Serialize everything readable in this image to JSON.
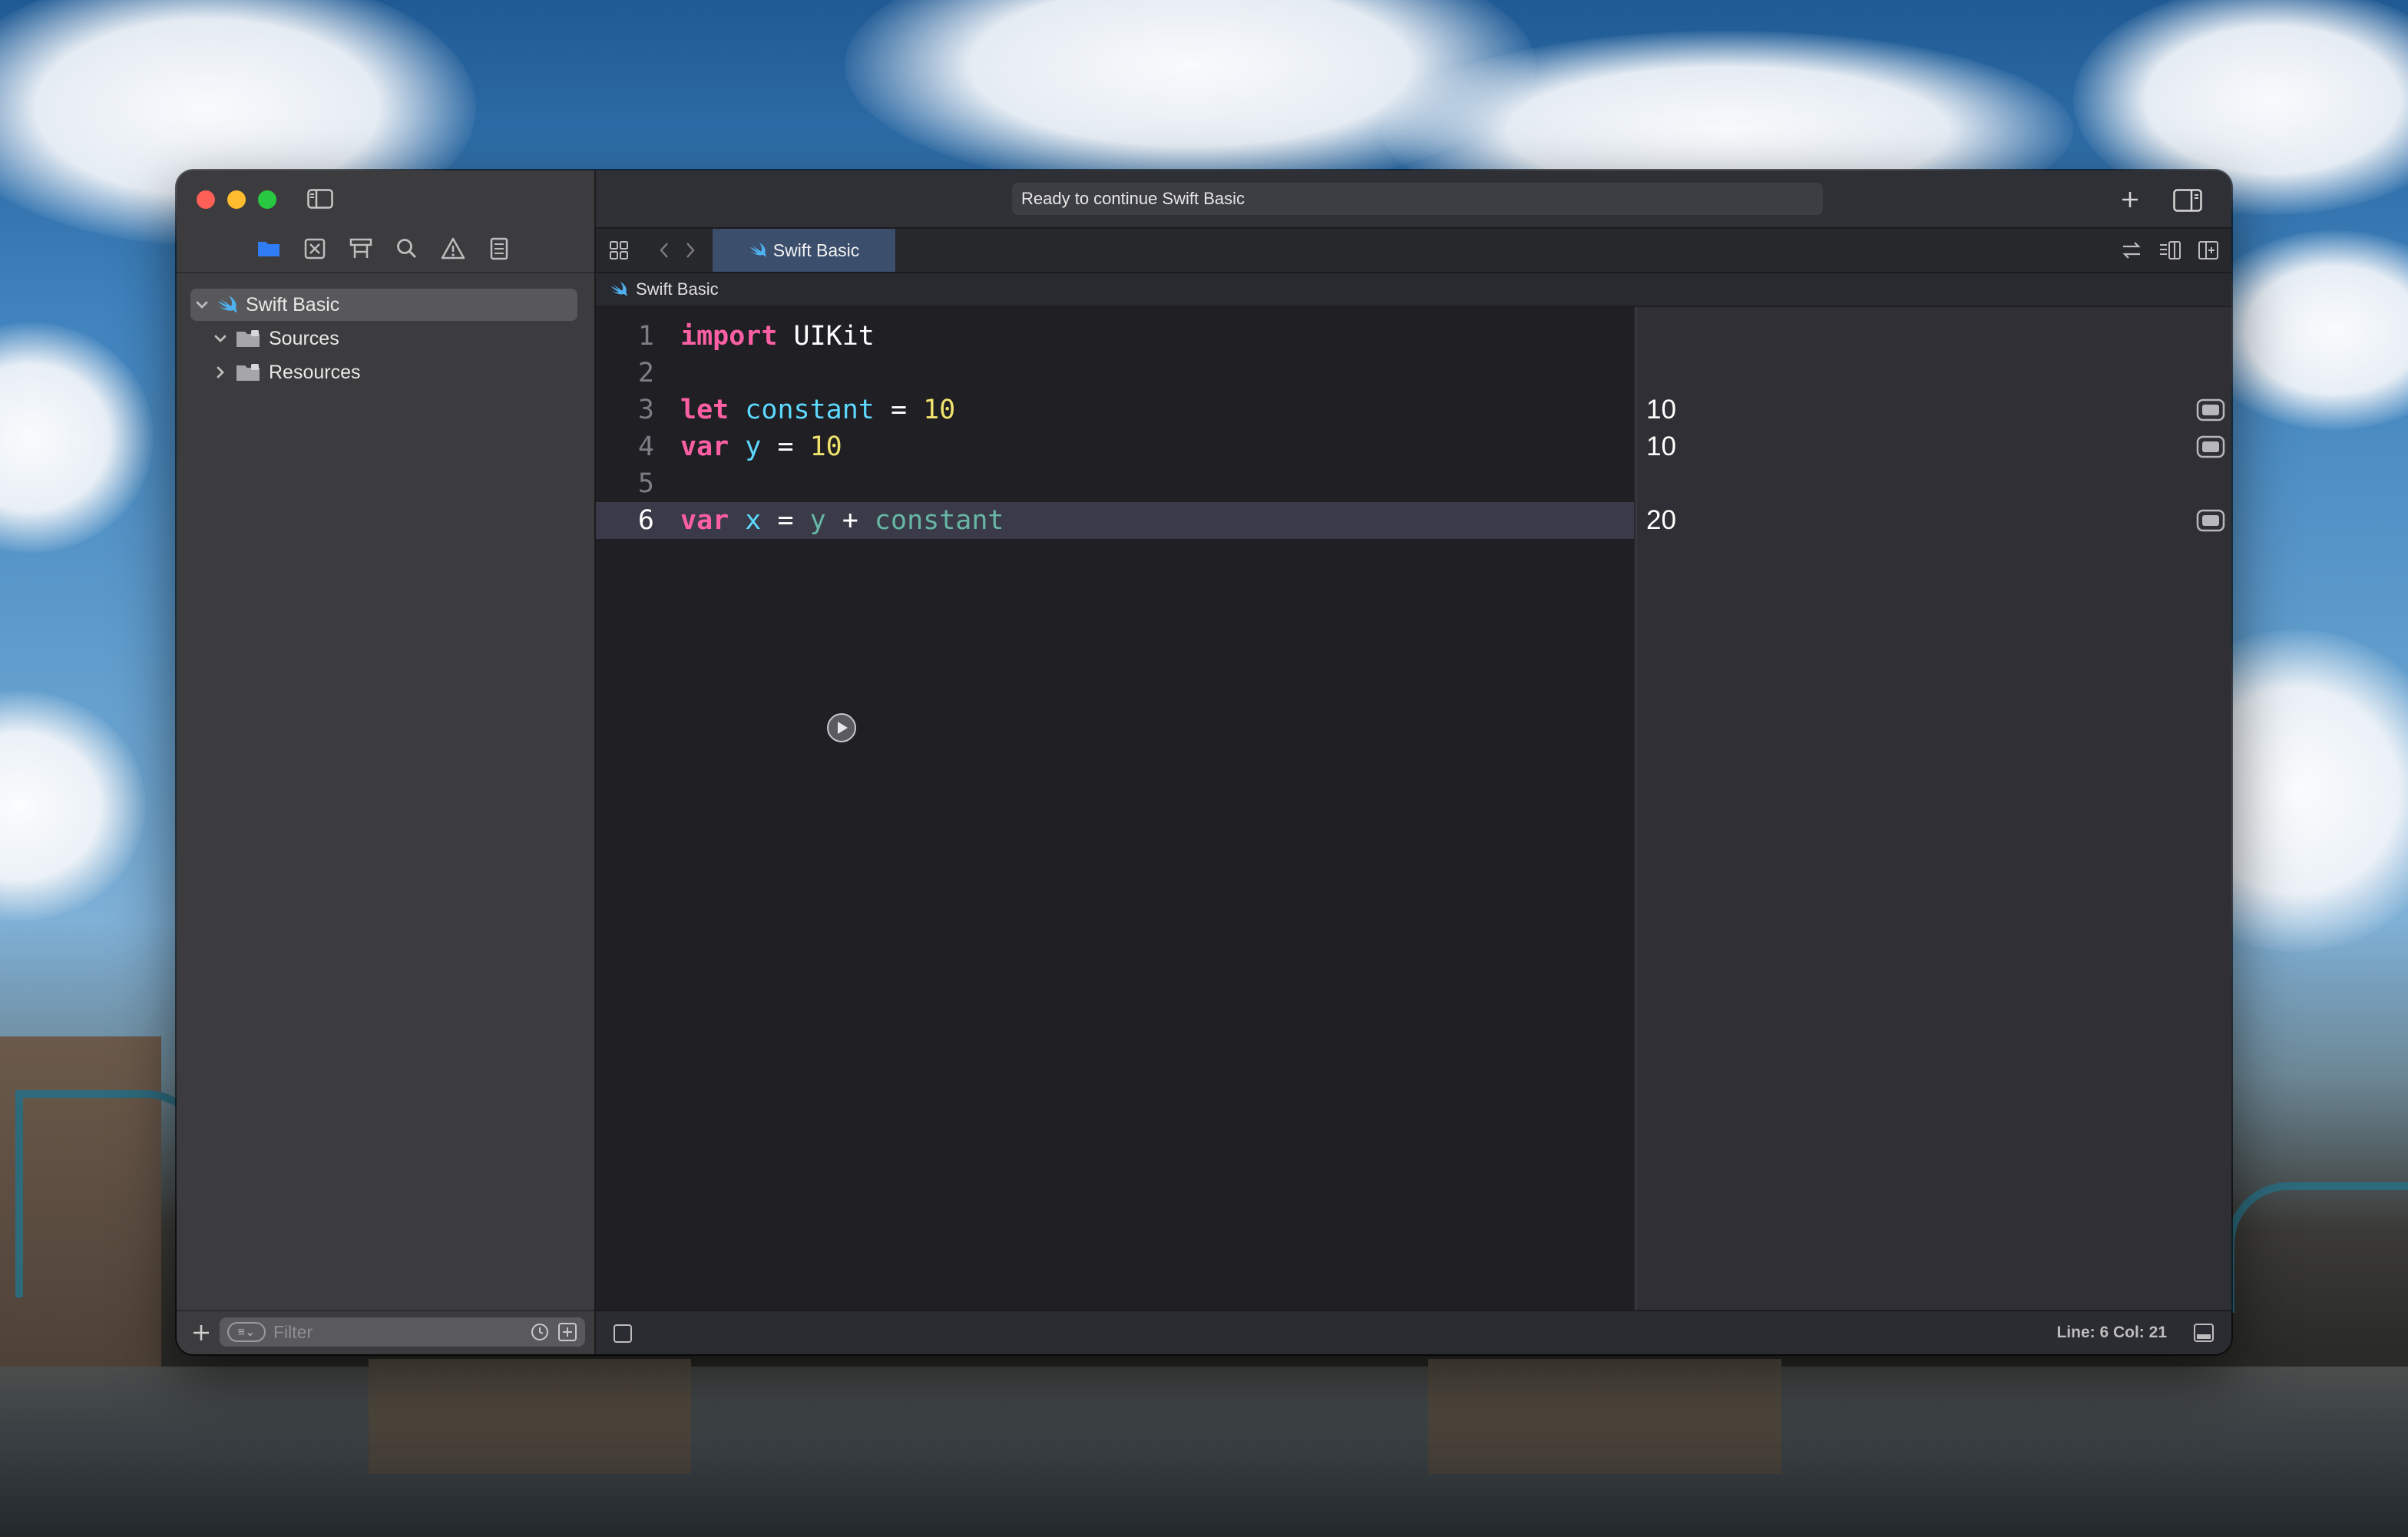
{
  "window": {
    "activity_text": "Ready to continue Swift Basic"
  },
  "navigator": {
    "items": [
      {
        "label": "Swift Basic",
        "expanded": true,
        "selected": true
      },
      {
        "label": "Sources",
        "expanded": true
      },
      {
        "label": "Resources",
        "expanded": false
      }
    ],
    "filter_placeholder": "Filter"
  },
  "editor": {
    "tab_label": "Swift Basic",
    "breadcrumb": "Swift Basic",
    "current_line": 6,
    "lines": [
      {
        "num": "1"
      },
      {
        "num": "2"
      },
      {
        "num": "3"
      },
      {
        "num": "4"
      },
      {
        "num": "5"
      },
      {
        "num": "6"
      }
    ],
    "tokens": {
      "l1_import": "import",
      "l1_uikit": "UIKit",
      "l3_let": "let",
      "l3_constant": "constant",
      "l3_eq": "=",
      "l3_ten": "10",
      "l4_var": "var",
      "l4_y": "y",
      "l4_eq": "=",
      "l4_ten": "10",
      "l6_var": "var",
      "l6_x": "x",
      "l6_eq": "=",
      "l6_y": "y",
      "l6_plus": "+",
      "l6_constant": "constant"
    }
  },
  "results": {
    "line3": "10",
    "line4": "10",
    "line6": "20"
  },
  "status": {
    "position": "Line: 6  Col: 21"
  },
  "colors": {
    "keyword": "#fc5fa3",
    "identifier": "#5dd8ff",
    "number": "#f0e26c",
    "tab_active": "#3b4e6b",
    "current_line": "#3a3a48"
  }
}
